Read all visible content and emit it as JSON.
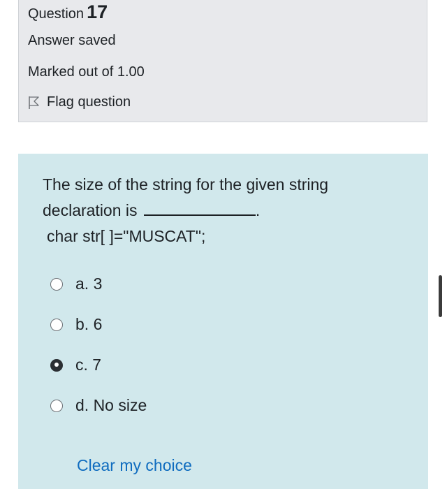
{
  "info": {
    "question_label": "Question",
    "question_number": "17",
    "state": "Answer saved",
    "grade": "Marked out of 1.00",
    "flag_label": "Flag question"
  },
  "question": {
    "line1": "The size of the string for the given string",
    "line2_prefix": "declaration is",
    "line2_suffix": ".",
    "code": "char str[ ]=\"MUSCAT\";"
  },
  "answers": [
    {
      "label": "a. 3",
      "selected": false
    },
    {
      "label": "b. 6",
      "selected": false
    },
    {
      "label": "c. 7",
      "selected": true
    },
    {
      "label": "d. No size",
      "selected": false
    }
  ],
  "clear_label": "Clear my choice",
  "colors": {
    "info_bg": "#e8e9ec",
    "formulation_bg": "#d1e8ec",
    "link": "#0f6cbf"
  }
}
